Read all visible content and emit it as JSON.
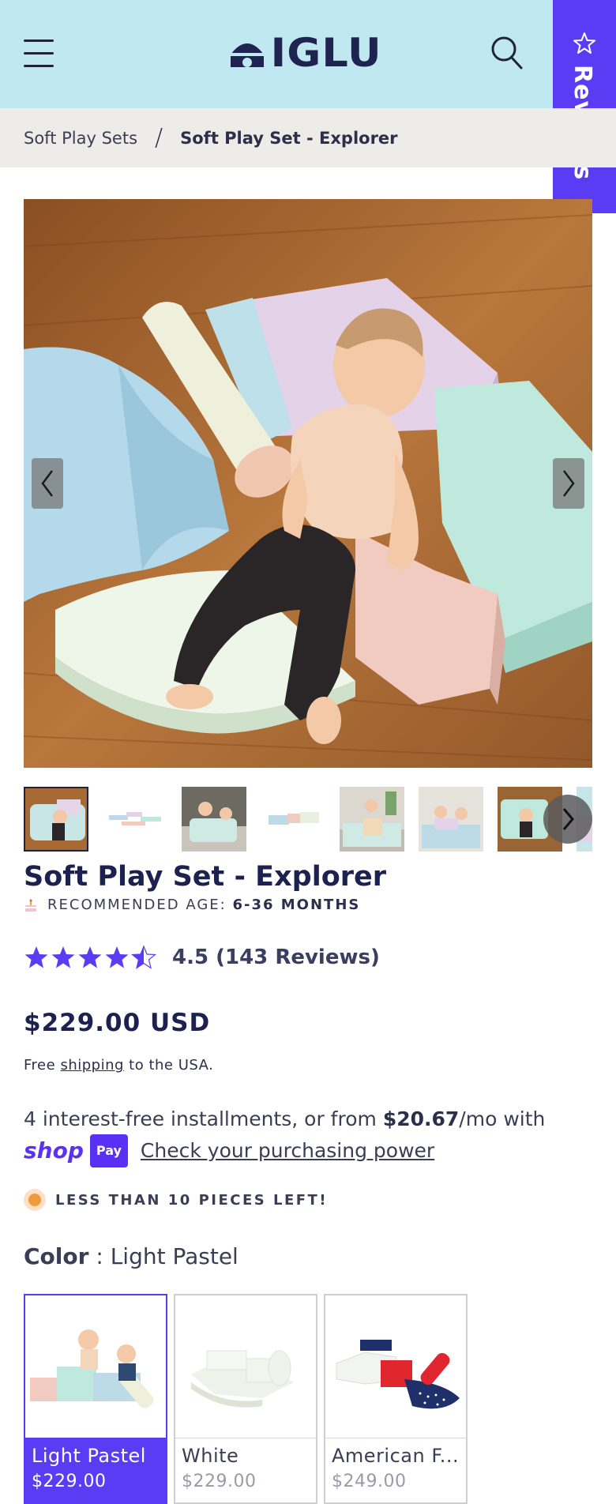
{
  "header": {
    "logo_text": "IGLU",
    "reviews_tab_label": "Reviews"
  },
  "breadcrumb": {
    "parent": "Soft Play Sets",
    "separator": "/",
    "current": "Soft Play Set - Explorer"
  },
  "gallery": {
    "thumbnail_count": 8,
    "active_index": 0
  },
  "product": {
    "title": "Soft Play Set - Explorer",
    "age_label": "RECOMMENDED AGE:",
    "age_value": "6-36 MONTHS",
    "rating_value": 4.5,
    "rating_text": "4.5 (143 Reviews)",
    "price": "$229.00 USD",
    "shipping_prefix": "Free",
    "shipping_link": "shipping",
    "shipping_suffix": "to the USA.",
    "installments_prefix": "4 interest-free installments, or from",
    "installments_amount": "$20.67",
    "installments_suffix": "/mo with",
    "shop_word": "shop",
    "shop_pay_badge": "Pay",
    "purchasing_power_link": "Check your purchasing power",
    "stock_message": "LESS THAN 10 PIECES LEFT!"
  },
  "color": {
    "label": "Color",
    "separator": ":",
    "selected": "Light Pastel",
    "options": [
      {
        "name": "Light Pastel",
        "price": "$229.00"
      },
      {
        "name": "White",
        "price": "$229.00"
      },
      {
        "name": "American F...",
        "price": "$249.00"
      }
    ]
  },
  "colors": {
    "header_bg": "#bfe8f0",
    "accent": "#5b3cf5",
    "navy": "#1d2150",
    "breadcrumb_bg": "#eeece8",
    "stock_dot": "#f29a3a"
  }
}
